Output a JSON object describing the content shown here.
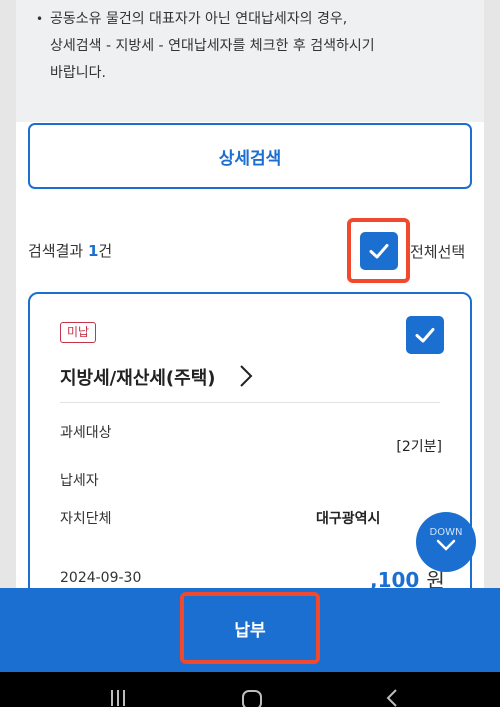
{
  "notice": {
    "lines": [
      "공동소유 물건의 대표자가 아닌 연대납세자의 경우,",
      "상세검색 - 지방세 - 연대납세자를 체크한 후 검색하시기",
      "바랍니다."
    ]
  },
  "detail_search_button": "상세검색",
  "results": {
    "prefix": "검색결과 ",
    "count": "1",
    "suffix": "건",
    "select_all_label": "전체선택",
    "select_all_checked": true
  },
  "card": {
    "badge": "미납",
    "title": "지방세/재산세(주택)",
    "checked": true,
    "rows": [
      {
        "label": "과세대상",
        "value": "[2기분]"
      },
      {
        "label": "납세자",
        "value": ""
      },
      {
        "label": "자치단체",
        "value": "대구광역시"
      }
    ],
    "due_date": "2024-09-30",
    "amount": ",100",
    "amount_unit": "원"
  },
  "down_button": "DOWN",
  "pay_button": "납부",
  "colors": {
    "primary": "#1a6fd1",
    "highlight": "#f0492e",
    "badge": "#c7344a"
  },
  "icons": [
    "checkmark-icon",
    "chevron-right-icon",
    "chevron-down-icon",
    "recent-apps-icon",
    "home-icon",
    "back-icon"
  ]
}
